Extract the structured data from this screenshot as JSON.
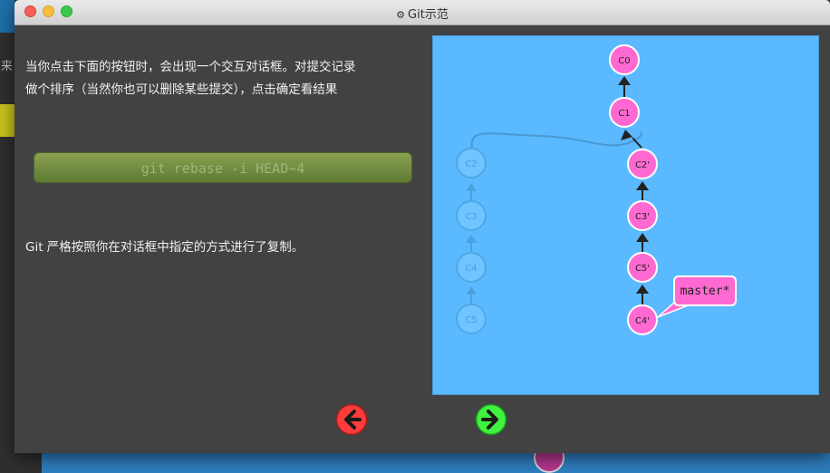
{
  "window": {
    "title": "Git示范",
    "title_icon": "gear-icon"
  },
  "background": {
    "left_char": "来"
  },
  "content": {
    "intro_line1": "当你点击下面的按钮时，会出现一个交互对话框。对提交记录",
    "intro_line2": "做个排序（当然你也可以删除某些提交），点击确定看结果",
    "command": "git rebase -i HEAD~4",
    "result": "Git 严格按照你在对话框中指定的方式进行了复制。"
  },
  "graph": {
    "colors": {
      "canvas": "#5bb9ff",
      "node": "#ff69d1",
      "ghost": "#6ec7ff",
      "branch_label": "#ff69d1"
    },
    "commits": [
      {
        "id": "C0",
        "faded": false
      },
      {
        "id": "C1",
        "faded": false
      },
      {
        "id": "C2'",
        "faded": false
      },
      {
        "id": "C3'",
        "faded": false
      },
      {
        "id": "C5'",
        "faded": false
      },
      {
        "id": "C4'",
        "faded": false
      },
      {
        "id": "C2",
        "faded": true
      },
      {
        "id": "C3",
        "faded": true
      },
      {
        "id": "C4",
        "faded": true
      },
      {
        "id": "C5",
        "faded": true
      }
    ],
    "branch": {
      "name": "master*",
      "target": "C4'"
    }
  },
  "nav": {
    "back_icon": "arrow-left-icon",
    "back_color": "#f33",
    "forward_icon": "arrow-right-icon",
    "forward_color": "#3f3"
  }
}
